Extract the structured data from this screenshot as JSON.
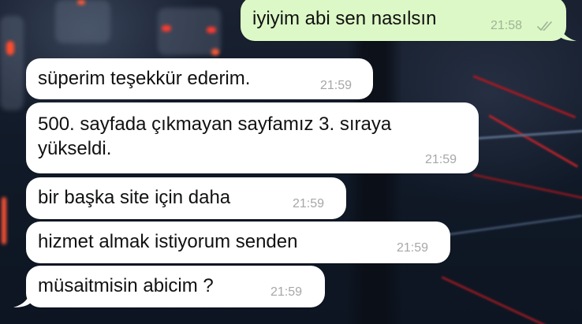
{
  "wallpaper": "night-highway-wallpaper",
  "messages": [
    {
      "direction": "out",
      "text": "iyiyim abi sen nasılsın",
      "time": "21:58",
      "status_icon": "double-check-icon"
    },
    {
      "direction": "in",
      "text": "süperim teşekkür ederim.",
      "time": "21:59"
    },
    {
      "direction": "in",
      "lines": [
        "500. sayfada çıkmayan sayfamız 3. sıraya",
        "yükseldi."
      ],
      "time": "21:59"
    },
    {
      "direction": "in",
      "text": "bir başka site için daha",
      "time": "21:59"
    },
    {
      "direction": "in",
      "text": "hizmet almak istiyorum senden",
      "time": "21:59"
    },
    {
      "direction": "in",
      "text": "müsaitmisin abicim ?",
      "time": "21:59"
    }
  ],
  "colors": {
    "incoming_bubble": "#ffffff",
    "outgoing_bubble": "#dcf8c6",
    "timestamp": "#a7a7a7"
  }
}
